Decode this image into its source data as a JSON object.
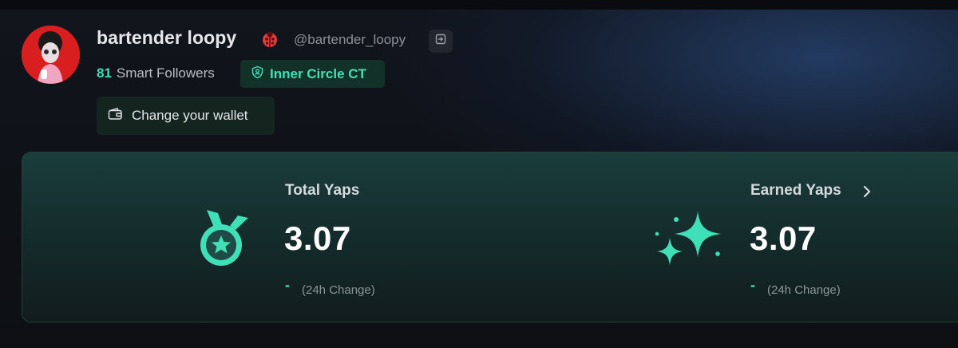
{
  "profile": {
    "name": "bartender loopy",
    "handle": "@bartender_loopy",
    "smart_followers_count": "81",
    "smart_followers_label": "Smart Followers",
    "badge_label": "Inner Circle CT",
    "change_wallet_label": "Change your wallet"
  },
  "stats": {
    "total": {
      "title": "Total Yaps",
      "value": "3.07",
      "dash": "-",
      "change_label": "(24h Change)"
    },
    "earned": {
      "title": "Earned Yaps",
      "value": "3.07",
      "dash": "-",
      "change_label": "(24h Change)"
    }
  },
  "icons": {
    "ladybug": "ladybug-icon",
    "login": "sign-in-icon",
    "badge": "shield-icon",
    "wallet": "wallet-icon",
    "medal": "medal-icon",
    "sparkles": "sparkles-icon",
    "chevron": "chevron-right-icon"
  },
  "colors": {
    "accent": "#3fe0b7",
    "background": "#0d0f13",
    "panel": "#1a3d3c",
    "ladybug": "#e23b3b"
  }
}
